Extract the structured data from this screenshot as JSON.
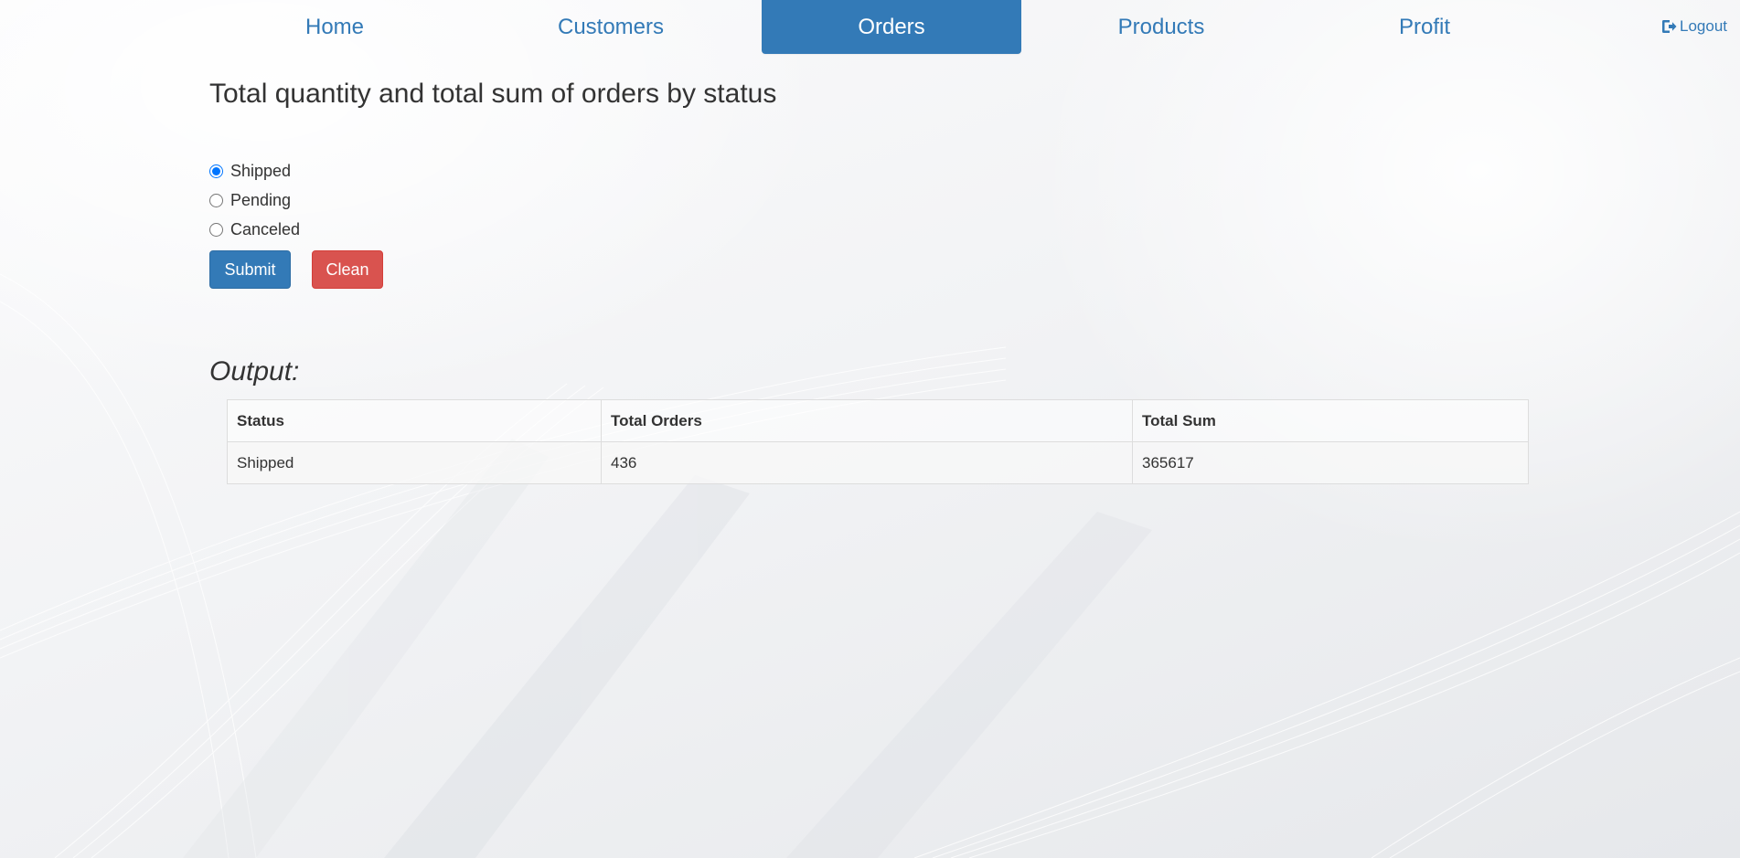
{
  "nav": {
    "tabs": [
      {
        "label": "Home",
        "active": false
      },
      {
        "label": "Customers",
        "active": false
      },
      {
        "label": "Orders",
        "active": true
      },
      {
        "label": "Products",
        "active": false
      },
      {
        "label": "Profit",
        "active": false
      }
    ],
    "logout_label": "Logout",
    "logout_icon": "logout-icon"
  },
  "main": {
    "title": "Total quantity and total sum of orders by status",
    "status_options": [
      {
        "label": "Shipped",
        "checked": true
      },
      {
        "label": "Pending",
        "checked": false
      },
      {
        "label": "Canceled",
        "checked": false
      }
    ],
    "submit_label": "Submit",
    "clean_label": "Clean",
    "output_label": "Output:"
  },
  "output_table": {
    "headers": [
      "Status",
      "Total Orders",
      "Total Sum"
    ],
    "rows": [
      [
        "Shipped",
        "436",
        "365617"
      ]
    ]
  },
  "colors": {
    "primary": "#337ab7",
    "danger": "#d9534f",
    "text": "#333333"
  }
}
